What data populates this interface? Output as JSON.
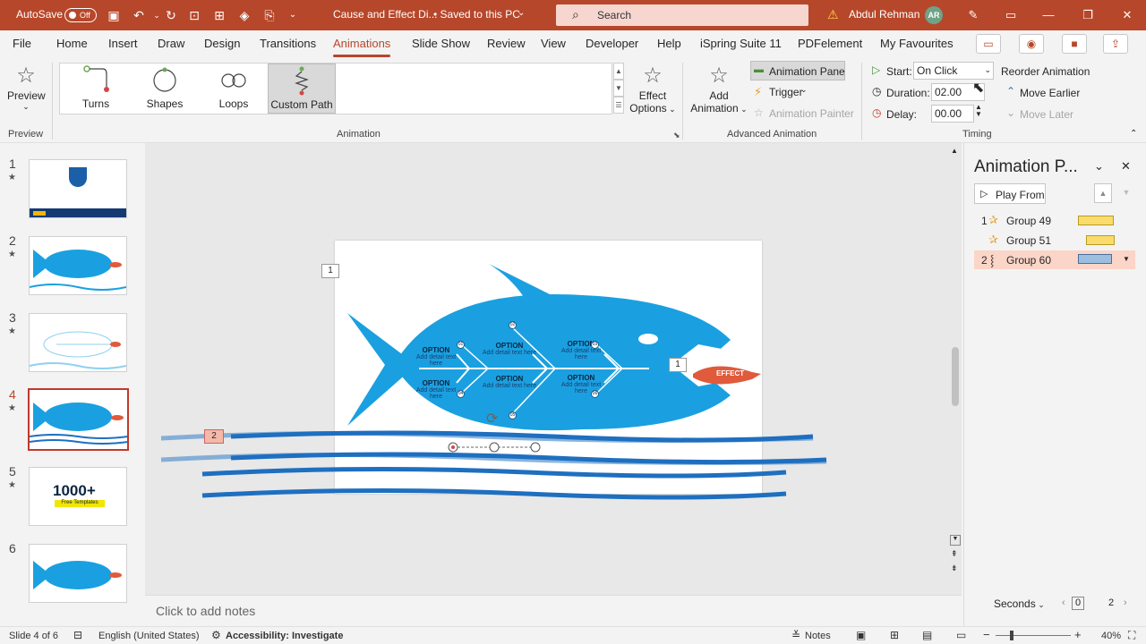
{
  "titlebar": {
    "autosave_label": "AutoSave",
    "autosave_state": "Off",
    "doc_title": "Cause and Effect Di...",
    "save_status": "• Saved to this PC",
    "search_placeholder": "Search",
    "user_name": "Abdul Rehman",
    "user_initials": "AR"
  },
  "tabs": [
    "File",
    "Home",
    "Insert",
    "Draw",
    "Design",
    "Transitions",
    "Animations",
    "Slide Show",
    "Review",
    "View",
    "Developer",
    "Help",
    "iSpring Suite 11",
    "PDFelement",
    "My Favourites"
  ],
  "active_tab": "Animations",
  "ribbon": {
    "preview": {
      "label": "Preview",
      "group": "Preview"
    },
    "gallery": [
      {
        "label": "Turns",
        "icon": "turns-path-icon"
      },
      {
        "label": "Shapes",
        "icon": "circle-path-icon"
      },
      {
        "label": "Loops",
        "icon": "loops-path-icon"
      },
      {
        "label": "Custom Path",
        "icon": "custom-path-icon",
        "selected": true
      }
    ],
    "effect_options": {
      "line1": "Effect",
      "line2": "Options"
    },
    "animation_group": "Animation",
    "add_animation": {
      "line1": "Add",
      "line2": "Animation"
    },
    "animation_pane": "Animation Pane",
    "trigger": "Trigger",
    "animation_painter": "Animation Painter",
    "advanced_group": "Advanced Animation",
    "start_label": "Start:",
    "start_value": "On Click",
    "duration_label": "Duration:",
    "duration_value": "02.00",
    "delay_label": "Delay:",
    "delay_value": "00.00",
    "reorder": "Reorder Animation",
    "move_earlier": "Move Earlier",
    "move_later": "Move Later",
    "timing_group": "Timing"
  },
  "slides": [
    {
      "num": "1",
      "star": "★"
    },
    {
      "num": "2",
      "star": "★"
    },
    {
      "num": "3",
      "star": "★"
    },
    {
      "num": "4",
      "star": "★",
      "active": true
    },
    {
      "num": "5",
      "star": "★"
    },
    {
      "num": "6",
      "star": ""
    }
  ],
  "slide": {
    "options": [
      {
        "title": "OPTION",
        "text": "Add detail text here",
        "num": "01"
      },
      {
        "title": "OPTION",
        "text": "Add detail text here",
        "num": "02"
      },
      {
        "title": "OPTION",
        "text": "Add detail text here",
        "num": "03"
      },
      {
        "title": "OPTION",
        "text": "Add detail text here",
        "num": "04"
      },
      {
        "title": "OPTION",
        "text": "Add detail text here",
        "num": "05"
      },
      {
        "title": "OPTION",
        "text": "Add detail text here",
        "num": "06"
      }
    ],
    "effect_label": "EFFECT",
    "anim_tag_1": "1",
    "anim_tag_fish": "1",
    "anim_tag_2": "2"
  },
  "notes_placeholder": "Click to add notes",
  "animation_pane": {
    "title": "Animation P...",
    "play_from": "Play From",
    "items": [
      {
        "num": "1",
        "name": "Group 49"
      },
      {
        "num": "",
        "name": "Group 51"
      },
      {
        "num": "2",
        "name": "Group 60",
        "selected": true
      }
    ],
    "seconds": "Seconds",
    "timeline_start": "0",
    "timeline_end": "2"
  },
  "status": {
    "slide_info": "Slide 4 of 6",
    "language": "English (United States)",
    "accessibility": "Accessibility: Investigate",
    "notes": "Notes",
    "zoom": "40%"
  },
  "colors": {
    "accent": "#b7472a",
    "fish": "#1aa0e0",
    "effect": "#e05a3c",
    "wave": "#1e6fc0"
  }
}
